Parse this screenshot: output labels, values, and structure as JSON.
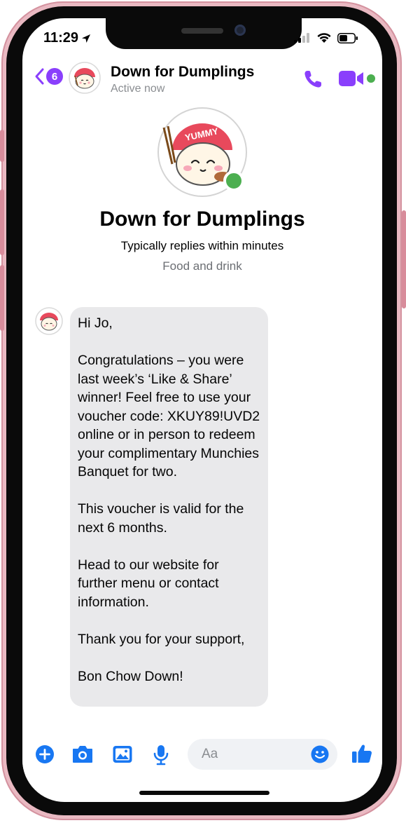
{
  "status_bar": {
    "time": "11:29"
  },
  "header": {
    "back_count": "6",
    "title": "Down for Dumplings",
    "subtitle": "Active now"
  },
  "profile": {
    "name": "Down for Dumplings",
    "reply_time": "Typically replies within minutes",
    "category": "Food and drink",
    "avatar_text": "YUMMY"
  },
  "message": {
    "paragraphs": [
      "Hi Jo,",
      "Congratulations – you were last week’s ‘Like & Share’ winner! Feel free to use your voucher code: XKUY89!UVD2 online or in person to redeem your complimentary Munchies Banquet for two.",
      "This voucher is valid for the next 6 months.",
      "Head to our website for further menu or contact information.",
      "Thank you for your support,",
      "Bon Chow Down!"
    ]
  },
  "composer": {
    "placeholder": "Aa"
  },
  "colors": {
    "accent_purple": "#8a3ffc",
    "accent_blue": "#1877f2",
    "online_green": "#4caf50",
    "bubble_gray": "#e9e9eb"
  },
  "icons": {
    "call": "phone-icon",
    "video": "video-camera-icon",
    "add": "plus-circle-icon",
    "camera": "camera-icon",
    "gallery": "image-icon",
    "voice": "microphone-icon",
    "emoji": "smiley-icon",
    "like": "thumbs-up-icon"
  }
}
